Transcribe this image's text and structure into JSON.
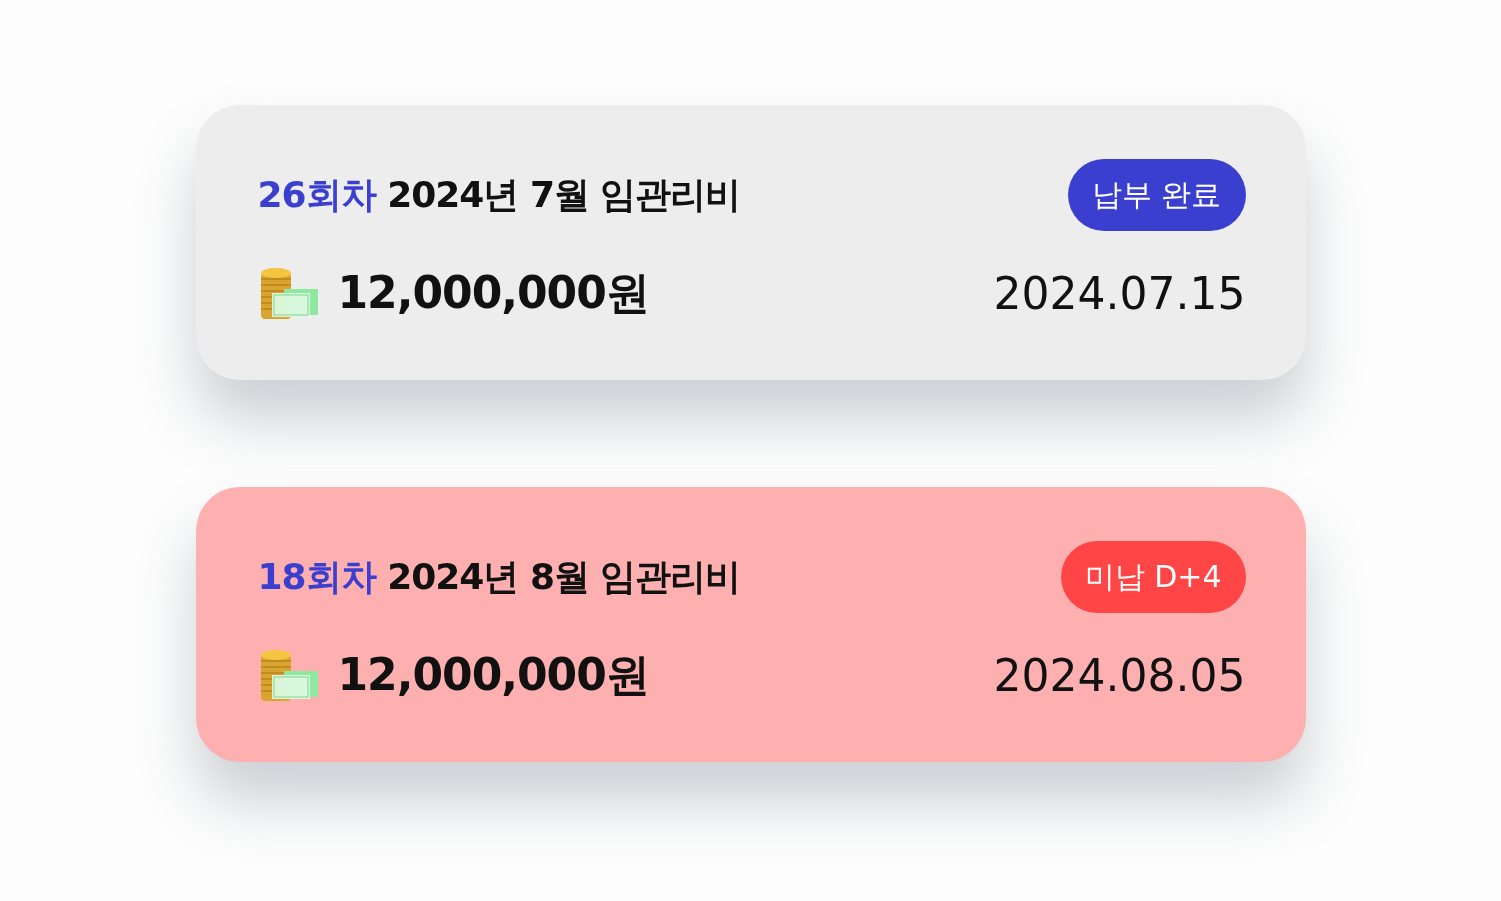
{
  "payments": [
    {
      "kind": "paid",
      "round": "26회차",
      "title": "2024년 7월 임관리비",
      "status": "납부 완료",
      "amount": "12,000,000원",
      "date": "2024.07.15"
    },
    {
      "kind": "overdue",
      "round": "18회차",
      "title": "2024년 8월 임관리비",
      "status": "미납 D+4",
      "amount": "12,000,000원",
      "date": "2024.08.05"
    }
  ]
}
